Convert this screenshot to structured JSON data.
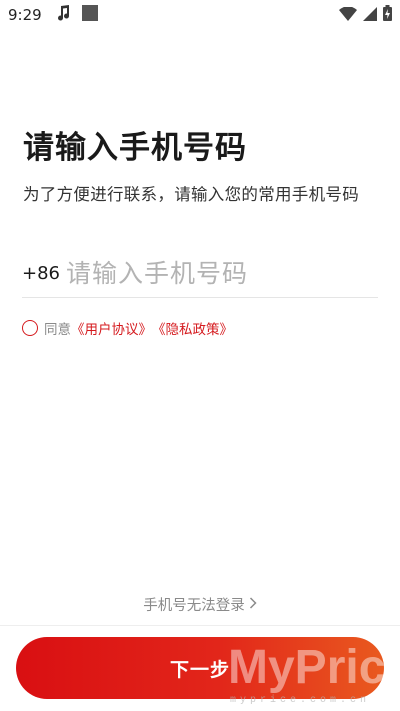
{
  "status_bar": {
    "time": "9:29",
    "icons": [
      "music-note-icon",
      "app-square-icon",
      "wifi-icon",
      "signal-icon",
      "battery-charging-icon"
    ]
  },
  "page": {
    "title": "请输入手机号码",
    "subtitle": "为了方便进行联系，请输入您的常用手机号码"
  },
  "phone": {
    "country_code": "+86",
    "placeholder": "请输入手机号码",
    "value": ""
  },
  "agreement": {
    "checked": false,
    "prefix": "同意",
    "user_agreement": "《用户协议》",
    "privacy_policy": "《隐私政策》"
  },
  "cannot_login": {
    "label": "手机号无法登录",
    "icon": "chevron-right-icon"
  },
  "next_button": {
    "label": "下一步"
  },
  "watermark": {
    "text": "MyPrice",
    "sub": "myprice.com.cn"
  },
  "colors": {
    "accent": "#d51a1e",
    "button_start": "#d90f12",
    "button_end": "#e95a1f"
  }
}
